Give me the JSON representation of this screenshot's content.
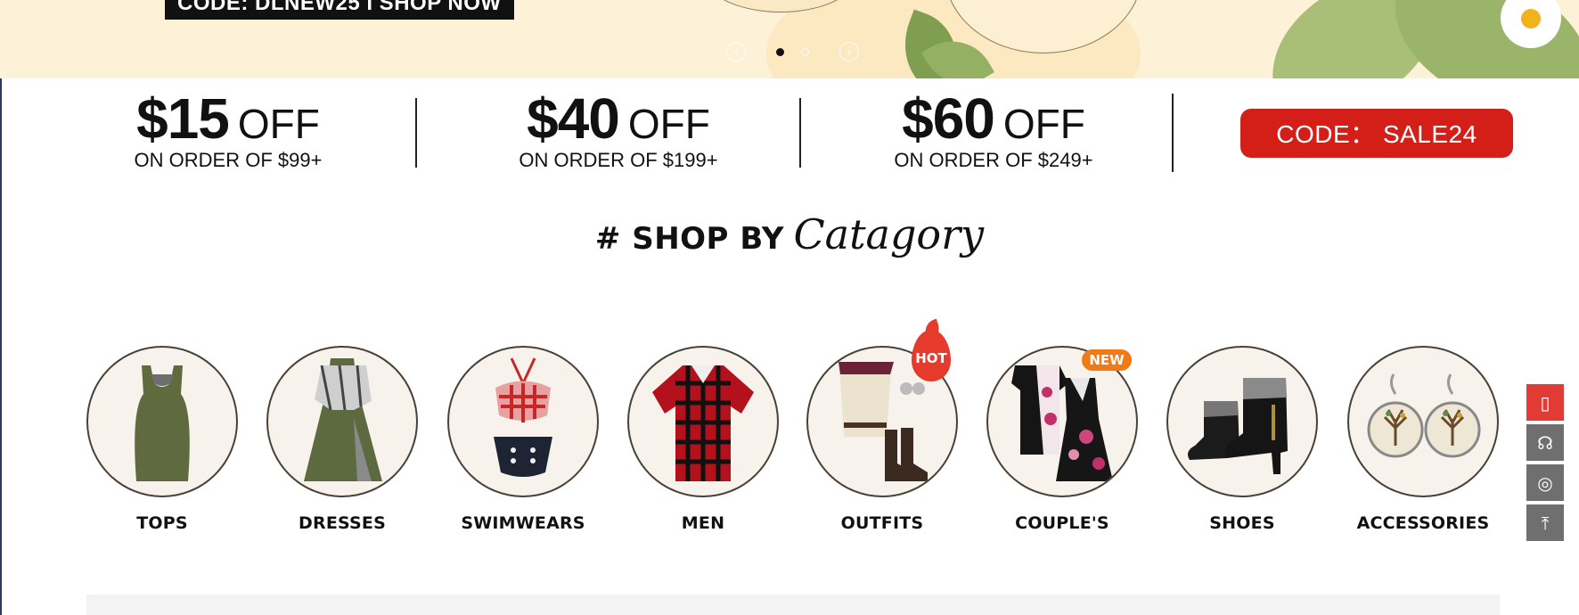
{
  "hero": {
    "code_text": "CODE: DLNEW25 I SHOP NOW",
    "prev_icon": "chevron-left-icon",
    "next_icon": "chevron-right-icon",
    "slides": 2,
    "active_slide": 1
  },
  "coupons": [
    {
      "amount": "$15",
      "off": "OFF",
      "condition": "ON ORDER OF $99+"
    },
    {
      "amount": "$40",
      "off": "OFF",
      "condition": "ON ORDER OF $199+"
    },
    {
      "amount": "$60",
      "off": "OFF",
      "condition": "ON ORDER OF $249+"
    }
  ],
  "coupon_code": {
    "label": "CODE： SALE24",
    "color": "#d41e18"
  },
  "section": {
    "prefix": "# SHOP BY",
    "script": "Catagory"
  },
  "categories": [
    {
      "label": "TOPS",
      "icon": "tank-top-icon"
    },
    {
      "label": "DRESSES",
      "icon": "dress-icon"
    },
    {
      "label": "SWIMWEARS",
      "icon": "bikini-icon"
    },
    {
      "label": "MEN",
      "icon": "plaid-shirt-icon"
    },
    {
      "label": "OUTFITS",
      "icon": "outfit-icon",
      "badge": "HOT"
    },
    {
      "label": "COUPLE'S",
      "icon": "couple-outfit-icon",
      "badge": "NEW"
    },
    {
      "label": "SHOES",
      "icon": "ankle-boots-icon"
    },
    {
      "label": "ACCESSORIES",
      "icon": "earrings-icon"
    }
  ],
  "float_toolbar": [
    {
      "icon": "mobile-phone-icon",
      "color": "#e23b36"
    },
    {
      "icon": "headset-icon"
    },
    {
      "icon": "cookie-icon"
    },
    {
      "icon": "back-to-top-icon"
    }
  ]
}
